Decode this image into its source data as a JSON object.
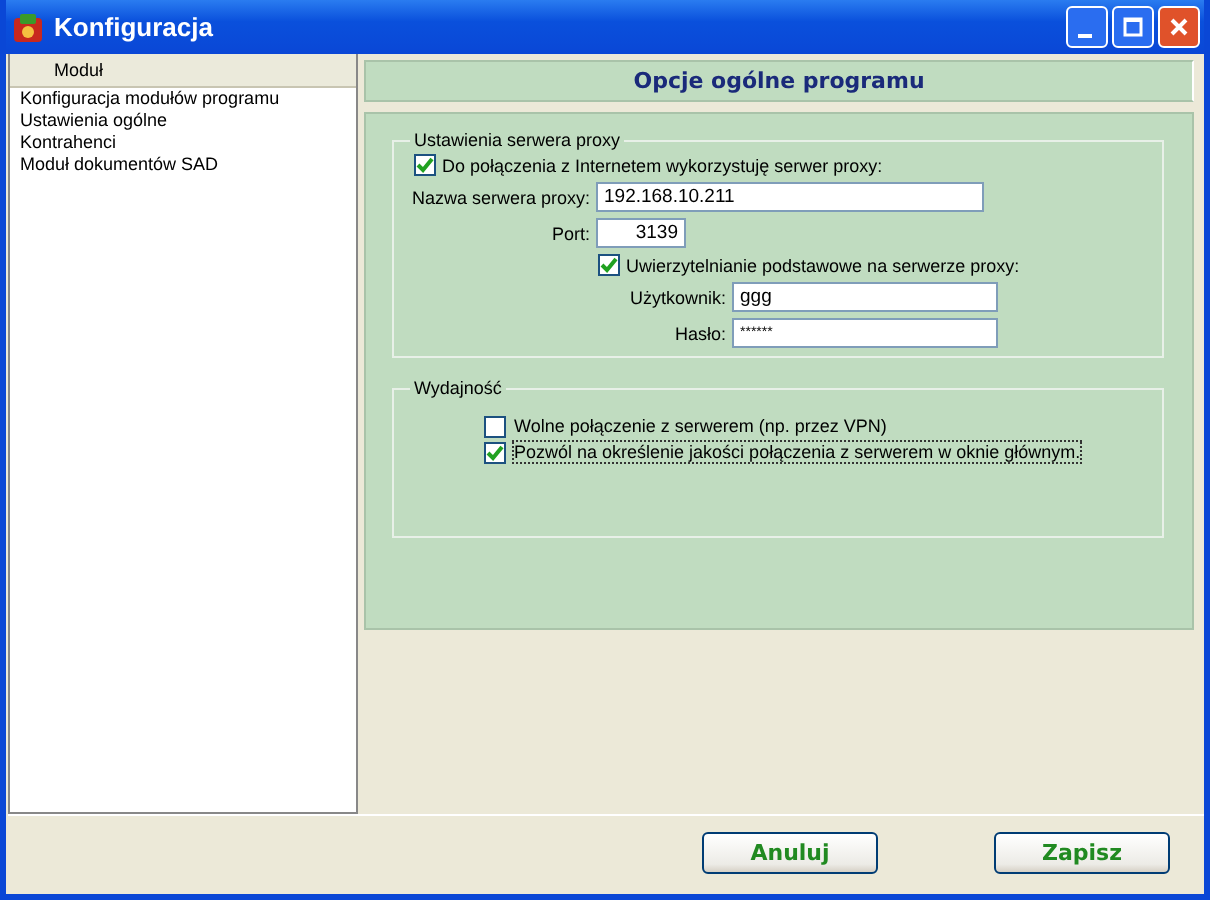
{
  "window": {
    "title": "Konfiguracja"
  },
  "sidebar": {
    "header": "Moduł",
    "items": [
      {
        "label": "Konfiguracja modułów programu",
        "selected": false
      },
      {
        "label": "Ustawienia ogólne",
        "selected": false
      },
      {
        "label": "Kontrahenci",
        "selected": false
      },
      {
        "label": "Moduł dokumentów SAD",
        "selected": false
      }
    ]
  },
  "panel": {
    "title": "Opcje ogólne programu"
  },
  "proxy": {
    "legend": "Ustawienia serwera proxy",
    "use_proxy": {
      "label": "Do połączenia z Internetem wykorzystuję serwer proxy:",
      "checked": true
    },
    "server": {
      "label": "Nazwa serwera proxy:",
      "value": "192.168.10.211"
    },
    "port": {
      "label": "Port:",
      "value": "3139"
    },
    "auth": {
      "label": "Uwierzytelnianie podstawowe na serwerze proxy:",
      "checked": true
    },
    "user": {
      "label": "Użytkownik:",
      "value": "ggg"
    },
    "password": {
      "label": "Hasło:",
      "value": "******"
    }
  },
  "performance": {
    "legend": "Wydajność",
    "options": [
      {
        "label": "Wolne połączenie z serwerem (np. przez VPN)",
        "checked": false,
        "focused": false
      },
      {
        "label": "Pozwól na określenie jakości połączenia z serwerem w oknie głównym.",
        "checked": true,
        "focused": true
      }
    ]
  },
  "buttons": [
    "Anuluj",
    "Zapisz"
  ]
}
